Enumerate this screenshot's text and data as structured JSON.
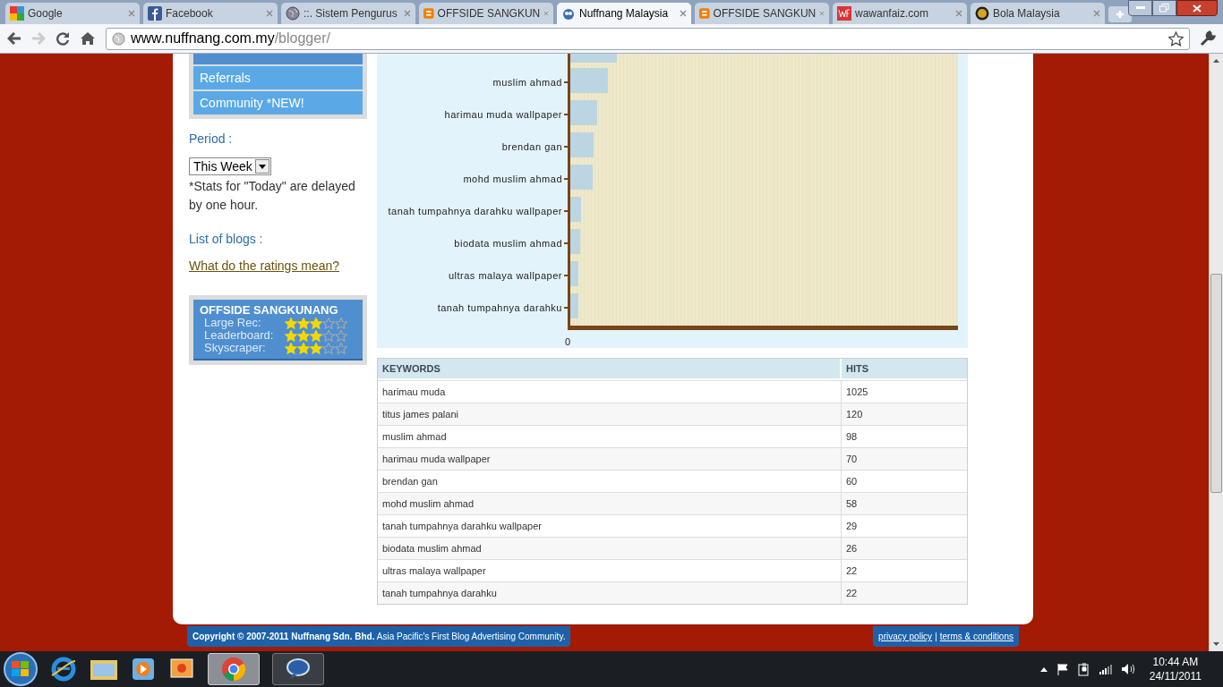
{
  "browser": {
    "tabs": [
      {
        "title": "Google",
        "kind": "google",
        "selected": false
      },
      {
        "title": "Facebook",
        "kind": "facebook",
        "selected": false
      },
      {
        "title": "::. Sistem Pengurus",
        "kind": "globe",
        "selected": false
      },
      {
        "title": "OFFSIDE SANGKUN",
        "kind": "blogger",
        "selected": false
      },
      {
        "title": "Nuffnang Malaysia",
        "kind": "nuffnang",
        "selected": true
      },
      {
        "title": "OFFSIDE SANGKUN",
        "kind": "blogger",
        "selected": false
      },
      {
        "title": "wawanfaiz.com",
        "kind": "wf",
        "selected": false
      },
      {
        "title": "Bola Malaysia",
        "kind": "bola",
        "selected": false
      }
    ],
    "address": {
      "host": "www.nuffnang.com.my",
      "path": "/blogger/"
    }
  },
  "sidebar": {
    "nav": [
      {
        "selected": true
      },
      {
        "label": "Referrals",
        "selected": false
      },
      {
        "label": "Community *NEW!",
        "selected": false
      }
    ],
    "period_label": "Period :",
    "period_select": "This Week",
    "note": "*Stats for \"Today\" are delayed by one hour.",
    "blogs_label": "List of blogs :",
    "ratings_link": "What do the ratings mean?",
    "blog": {
      "name": "OFFSIDE SANGKUNANG",
      "ratings": [
        {
          "label": "Large Rec:",
          "stars": 3
        },
        {
          "label": "Leaderboard:",
          "stars": 3
        },
        {
          "label": "Skyscraper:",
          "stars": 3
        }
      ]
    }
  },
  "chart": {
    "labels": [
      "muslim ahmad",
      "harimau muda wallpaper",
      "brendan gan",
      "mohd muslim ahmad",
      "tanah tumpahnya darahku wallpaper",
      "biodata muslim ahmad",
      "ultras malaya wallpaper",
      "tanah tumpahnya darahku"
    ],
    "axis_zero": "0"
  },
  "table": {
    "columns": [
      "KEYWORDS",
      "HITS"
    ],
    "rows": [
      {
        "keyword": "harimau muda",
        "hits": "1025"
      },
      {
        "keyword": "titus james palani",
        "hits": "120"
      },
      {
        "keyword": "muslim ahmad",
        "hits": "98"
      },
      {
        "keyword": "harimau muda wallpaper",
        "hits": "70"
      },
      {
        "keyword": "brendan gan",
        "hits": "60"
      },
      {
        "keyword": "mohd muslim ahmad",
        "hits": "58"
      },
      {
        "keyword": "tanah tumpahnya darahku wallpaper",
        "hits": "29"
      },
      {
        "keyword": "biodata muslim ahmad",
        "hits": "26"
      },
      {
        "keyword": "ultras malaya wallpaper",
        "hits": "22"
      },
      {
        "keyword": "tanah tumpahnya darahku",
        "hits": "22"
      }
    ]
  },
  "footer": {
    "copyright": "**Copyright © 2007-2011 Nuffnang Sdn. Bhd.** Asia Pacific's First Blog Advertising Community.",
    "links": [
      "privacy policy",
      "terms & conditions"
    ],
    "separator": "|"
  },
  "taskbar": {
    "time": "10:44 AM",
    "date": "24/11/2011"
  }
}
